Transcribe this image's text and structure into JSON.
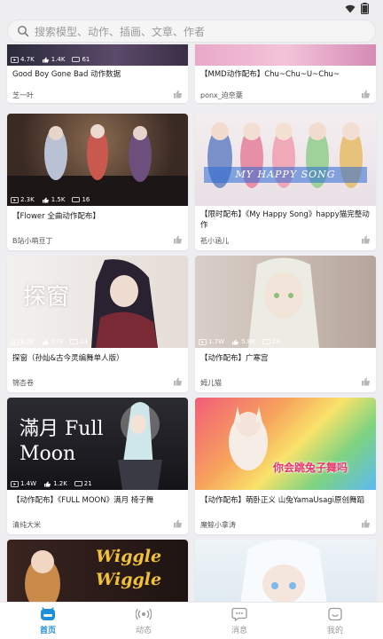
{
  "search": {
    "placeholder": "搜索模型、动作、插画、文章、作者"
  },
  "feed": {
    "cards": [
      {
        "title": "Good Boy Gone Bad 动作数据",
        "author": "芝一叶",
        "stats": [
          "4.7K",
          "1.4K",
          "61"
        ]
      },
      {
        "title": "【MMD动作配布】Chu~Chu~U~Chu~",
        "author": "ponx_迫奈葉",
        "stats": [
          "",
          "",
          ""
        ]
      },
      {
        "title": "【Flower 全曲动作配布】",
        "author": "B站小萌豆丁",
        "stats": [
          "2.3K",
          "1.5K",
          "16"
        ]
      },
      {
        "title": "【限时配布】《My Happy Song》happy猫完整动作",
        "author": "祇小涵儿",
        "stats": [
          "",
          "",
          ""
        ],
        "overlay_text": "MY HAPPY SONG"
      },
      {
        "title": "探窗（孙灿&古今灵编舞单人版）",
        "author": "锦杏卷",
        "stats": [
          "9.2K",
          "578",
          "23"
        ],
        "overlay_text": "探窗"
      },
      {
        "title": "【动作配布】广寒宫",
        "author": "姆儿猫",
        "stats": [
          "1.7W",
          "5.8K",
          "24"
        ]
      },
      {
        "title": "【动作配布】《FULL MOON》满月  椅子舞",
        "author": "清纯大米",
        "stats": [
          "1.4W",
          "1.2K",
          "21"
        ],
        "overlay_text": "滿月 Full Moon"
      },
      {
        "title": "【动作配布】萌卧正义 山兔YamaUsagi原创舞蹈",
        "author": "魔鲸小拿涛",
        "stats": [
          "",
          "",
          ""
        ],
        "overlay_text": "你会跳兔子舞吗"
      },
      {
        "title": "",
        "author": "",
        "stats": [
          "",
          "",
          ""
        ],
        "overlay_text": "Wiggle Wiggle"
      },
      {
        "title": "",
        "author": "",
        "stats": [
          "",
          "",
          ""
        ]
      }
    ]
  },
  "nav": {
    "items": [
      {
        "label": "首页",
        "icon": "home-icon",
        "active": true
      },
      {
        "label": "动态",
        "icon": "broadcast-icon",
        "active": false
      },
      {
        "label": "消息",
        "icon": "message-icon",
        "active": false
      },
      {
        "label": "我的",
        "icon": "profile-icon",
        "active": false
      }
    ]
  },
  "colors": {
    "accent": "#1e90d8",
    "background": "#eeeef0",
    "card": "#ffffff"
  }
}
